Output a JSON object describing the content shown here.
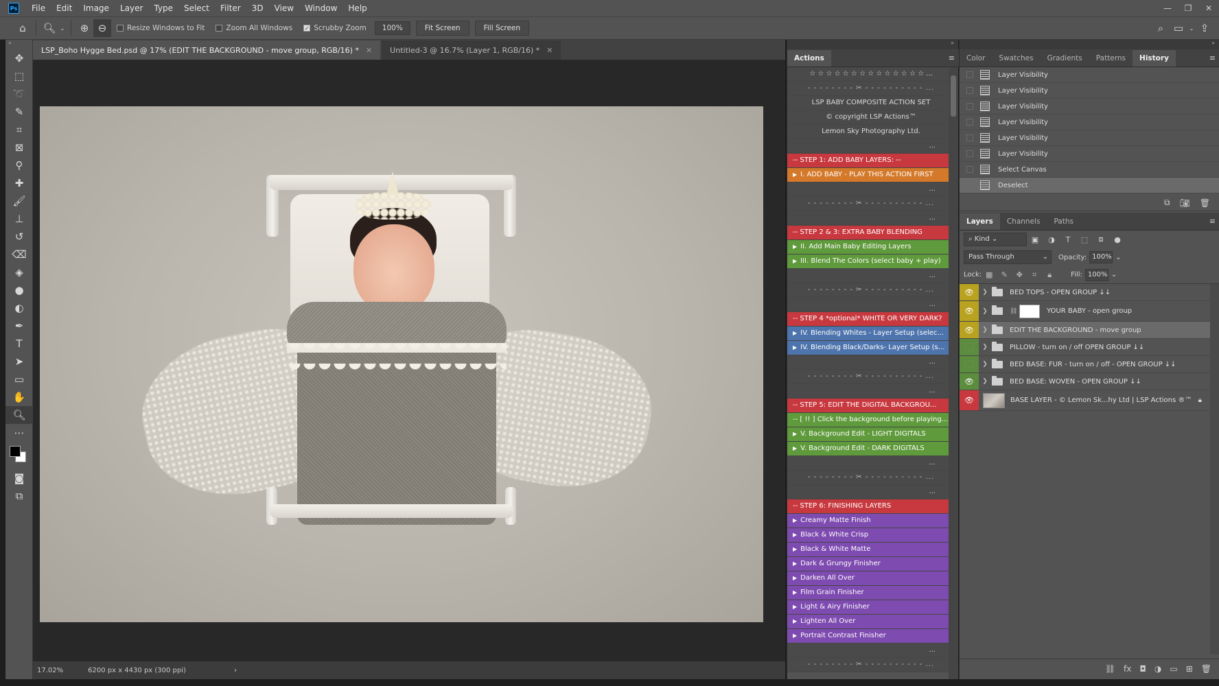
{
  "app": {
    "logo": "Ps"
  },
  "menu": [
    "File",
    "Edit",
    "Image",
    "Layer",
    "Type",
    "Select",
    "Filter",
    "3D",
    "View",
    "Window",
    "Help"
  ],
  "window_controls": {
    "minimize": "—",
    "restore": "❐",
    "close": "✕"
  },
  "options_bar": {
    "resize_windows": {
      "label": "Resize Windows to Fit",
      "checked": false
    },
    "zoom_all": {
      "label": "Zoom All Windows",
      "checked": false
    },
    "scrubby_zoom": {
      "label": "Scrubby Zoom",
      "checked": true
    },
    "zoom_value": "100%",
    "fit_screen": "Fit Screen",
    "fill_screen": "Fill Screen"
  },
  "tabs": [
    {
      "title": "LSP_Boho Hygge Bed.psd @ 17% (EDIT THE BACKGROUND - move group, RGB/16) *",
      "active": true
    },
    {
      "title": "Untitled-3 @ 16.7% (Layer 1, RGB/16) *",
      "active": false
    }
  ],
  "status": {
    "zoom": "17.02%",
    "doc_info": "6200 px x 4430 px (300 ppi)"
  },
  "actions_panel": {
    "tab": "Actions",
    "rows": [
      {
        "text": "☆ ☆ ☆ ☆ ☆ ☆ ☆ ☆ ☆ ☆ ☆ ☆ ☆ ☆ ...",
        "style": "plain"
      },
      {
        "text": "- - - - - - - - ✂ - - - - - - - - - - ...",
        "style": "sep"
      },
      {
        "text": "LSP BABY COMPOSITE ACTION SET",
        "style": "plain"
      },
      {
        "text": "© copyright LSP Actions™",
        "style": "plain"
      },
      {
        "text": "Lemon Sky Photography Ltd.",
        "style": "plain"
      },
      {
        "text": "...",
        "style": "dots"
      },
      {
        "text": "-- STEP 1: ADD BABY LAYERS: --",
        "style": "red"
      },
      {
        "text": "I. ADD BABY - PLAY THIS ACTION FIRST",
        "style": "orange",
        "play": true
      },
      {
        "text": "...",
        "style": "dots"
      },
      {
        "text": "- - - - - - - - ✂ - - - - - - - - - - ...",
        "style": "sep"
      },
      {
        "text": "...",
        "style": "dots"
      },
      {
        "text": "-- STEP 2 & 3: EXTRA BABY BLENDING",
        "style": "red"
      },
      {
        "text": "II.  Add Main Baby Editing Layers",
        "style": "green",
        "play": true
      },
      {
        "text": "III. Blend The Colors (select baby + play)",
        "style": "green",
        "play": true
      },
      {
        "text": "...",
        "style": "dots"
      },
      {
        "text": "- - - - - - - - ✂ - - - - - - - - - - ...",
        "style": "sep"
      },
      {
        "text": "...",
        "style": "dots"
      },
      {
        "text": "-- STEP 4 *optional* WHITE OR VERY DARK?",
        "style": "red"
      },
      {
        "text": "IV. Blending Whites - Layer Setup (selec...",
        "style": "blue",
        "play": true
      },
      {
        "text": "IV. Blending Black/Darks- Layer Setup (s...",
        "style": "blue",
        "play": true
      },
      {
        "text": "...",
        "style": "dots"
      },
      {
        "text": "- - - - - - - - ✂ - - - - - - - - - - ...",
        "style": "sep"
      },
      {
        "text": "...",
        "style": "dots"
      },
      {
        "text": "-- STEP 5: EDIT THE DIGITAL BACKGROU...",
        "style": "red"
      },
      {
        "text": "-- [ !! ] Click the background before playing...",
        "style": "green"
      },
      {
        "text": "V. Background Edit - LIGHT DIGITALS",
        "style": "green",
        "play": true
      },
      {
        "text": "V. Background Edit - DARK DIGITALS",
        "style": "green",
        "play": true
      },
      {
        "text": "...",
        "style": "dots"
      },
      {
        "text": "- - - - - - - - ✂ - - - - - - - - - - ...",
        "style": "sep"
      },
      {
        "text": "...",
        "style": "dots"
      },
      {
        "text": "-- STEP 6: FINISHING LAYERS",
        "style": "red"
      },
      {
        "text": "Creamy Matte Finish",
        "style": "violet",
        "play": true
      },
      {
        "text": "Black & White Crisp",
        "style": "violet",
        "play": true
      },
      {
        "text": "Black & White Matte",
        "style": "violet",
        "play": true
      },
      {
        "text": "Dark & Grungy Finisher",
        "style": "violet",
        "play": true
      },
      {
        "text": "Darken All Over",
        "style": "violet",
        "play": true
      },
      {
        "text": "Film Grain Finisher",
        "style": "violet",
        "play": true
      },
      {
        "text": "Light & Airy Finisher",
        "style": "violet",
        "play": true
      },
      {
        "text": "Lighten All Over",
        "style": "violet",
        "play": true
      },
      {
        "text": "Portrait Contrast Finisher",
        "style": "violet",
        "play": true
      },
      {
        "text": "...",
        "style": "dots"
      },
      {
        "text": "- - - - - - - - ✂ - - - - - - - - - - ...",
        "style": "sep"
      }
    ]
  },
  "history_panel": {
    "tabs": [
      "Color",
      "Swatches",
      "Gradients",
      "Patterns",
      "History"
    ],
    "active_tab": "History",
    "items": [
      {
        "label": "Layer Visibility"
      },
      {
        "label": "Layer Visibility"
      },
      {
        "label": "Layer Visibility"
      },
      {
        "label": "Layer Visibility"
      },
      {
        "label": "Layer Visibility"
      },
      {
        "label": "Layer Visibility"
      },
      {
        "label": "Select Canvas"
      },
      {
        "label": "Deselect",
        "selected": true
      }
    ]
  },
  "layers_panel": {
    "tabs": [
      "Layers",
      "Channels",
      "Paths"
    ],
    "active_tab": "Layers",
    "kind": "Kind",
    "blend_mode": "Pass Through",
    "opacity_label": "Opacity:",
    "opacity": "100%",
    "lock_label": "Lock:",
    "fill_label": "Fill:",
    "fill": "100%",
    "layers": [
      {
        "name": "BED TOPS - OPEN GROUP ↓↓",
        "color": "yellow",
        "visible": true,
        "type": "group"
      },
      {
        "name": "YOUR BABY - open group",
        "color": "yellow",
        "visible": true,
        "type": "group-mask"
      },
      {
        "name": "EDIT THE BACKGROUND - move group",
        "color": "yellow",
        "visible": true,
        "type": "group",
        "selected": true
      },
      {
        "name": "PILLOW - turn on / off  OPEN GROUP ↓↓",
        "color": "green",
        "visible": false,
        "type": "group"
      },
      {
        "name": "BED BASE: FUR - turn on / off - OPEN GROUP ↓↓",
        "color": "green",
        "visible": false,
        "type": "group"
      },
      {
        "name": "BED BASE: WOVEN -  OPEN GROUP ↓↓",
        "color": "green",
        "visible": true,
        "type": "group"
      },
      {
        "name": "BASE LAYER - © Lemon Sk...hy Ltd | LSP Actions ®™",
        "color": "red",
        "visible": true,
        "type": "image",
        "locked": true
      }
    ]
  }
}
